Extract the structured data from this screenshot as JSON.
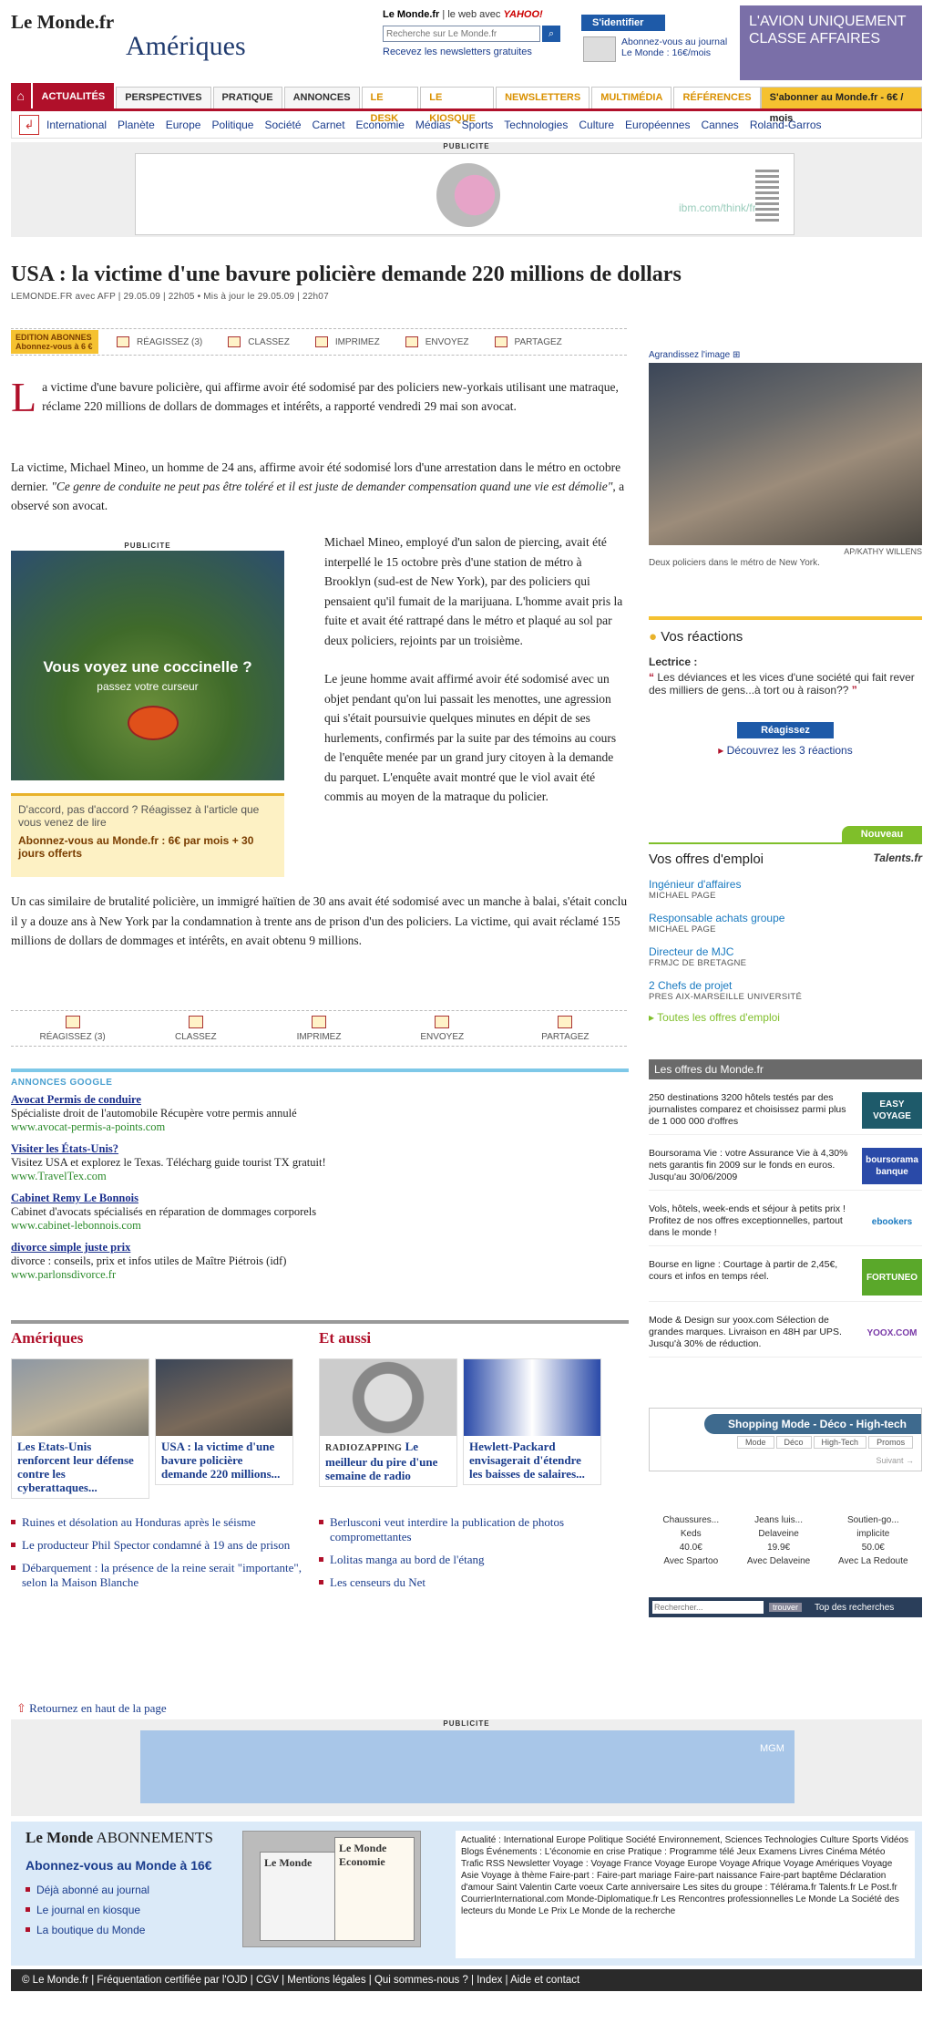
{
  "header": {
    "logo": "Le Monde.fr",
    "section": "Amériques",
    "search_brand": "Le Monde.fr",
    "search_sep": "le web avec",
    "yahoo": "YAHOO!",
    "search_placeholder": "Recherche sur Le Monde.fr",
    "newsletter": "Recevez les newsletters gratuites",
    "identify": "S'identifier",
    "subscribe_line1": "Abonnez-vous au journal",
    "subscribe_line2": "Le Monde : 16€/mois",
    "ad_top": "L'AVION UNIQUEMENT CLASSE AFFAIRES"
  },
  "nav": {
    "tabs": [
      "ACTUALITÉS",
      "PERSPECTIVES",
      "PRATIQUE",
      "ANNONCES",
      "LE DESK",
      "LE KIOSQUE",
      "NEWSLETTERS",
      "MULTIMÉDIA",
      "RÉFÉRENCES"
    ],
    "subscribe": "S'abonner au Monde.fr - 6€ / mois",
    "sub": [
      "International",
      "Planète",
      "Europe",
      "Politique",
      "Société",
      "Carnet",
      "Economie",
      "Médias",
      "Sports",
      "Technologies",
      "Culture",
      "Européennes",
      "Cannes",
      "Roland-Garros"
    ]
  },
  "ads": {
    "pub_label": "PUBLICITE",
    "ibm_url": "ibm.com/think/fr",
    "inline_title": "Vous voyez une coccinelle ?",
    "inline_sub": "passez votre curseur",
    "mgm": "MGM"
  },
  "article": {
    "headline": "USA : la victime d'une bavure policière demande 220 millions de dollars",
    "byline": "LEMONDE.FR avec AFP | 29.05.09 | 22h05 • Mis à jour le 29.05.09 | 22h07",
    "edition": "EDITION ABONNES Abonnez-vous à 6 €",
    "tools": [
      "RÉAGISSEZ (3)",
      "CLASSEZ",
      "IMPRIMEZ",
      "ENVOYEZ",
      "PARTAGEZ"
    ],
    "dropcap": "L",
    "lede": "a victime d'une bavure policière, qui affirme avoir été sodomisé par des policiers new-yorkais utilisant une matraque, réclame 220 millions de dollars de dommages et intérêts, a rapporté vendredi 29 mai son avocat.",
    "para2a": "La victime, Michael Mineo, un homme de 24 ans, affirme avoir été sodomisé lors d'une arrestation dans le métro en octobre dernier. ",
    "para2b": "\"Ce genre de conduite ne peut pas être toléré et il est juste de demander compensation quand une vie est démolie\"",
    "para2c": ", a observé son avocat.",
    "col1": "Michael Mineo, employé d'un salon de piercing, avait été interpellé le 15 octobre près d'une station de métro à Brooklyn (sud-est de New York), par des policiers qui pensaient qu'il fumait de la marijuana. L'homme avait pris la fuite et avait été rattrapé dans le métro et plaqué au sol par deux policiers, rejoints par un troisième.",
    "col2": "Le jeune homme avait affirmé avoir été sodomisé avec un objet pendant qu'on lui passait les menottes, une agression qui s'était poursuivie quelques minutes en dépit de ses hurlements, confirmés par la suite par des témoins au cours de l'enquête menée par un grand jury citoyen à la demande du parquet. L'enquête avait montré que le viol avait été commis au moyen de la matraque du policier.",
    "last": "Un cas similaire de brutalité policière, un immigré haïtien de 30 ans avait été sodomisé avec un manche à balai, s'était conclu il y a douze ans à New York par la condamnation à trente ans de prison d'un des policiers. La victime, qui avait réclamé 155 millions de dollars de dommages et intérêts, en avait obtenu 9 millions.",
    "react_box": "D'accord, pas d'accord ? Réagissez à l'article que vous venez de lire",
    "react_cta": "Abonnez-vous au Monde.fr : 6€ par mois + 30 jours offerts"
  },
  "google_ads": {
    "header": "ANNONCES GOOGLE",
    "items": [
      {
        "title": "Avocat Permis de conduire",
        "desc": "Spécialiste droit de l'automobile Récupère votre permis annulé",
        "url": "www.avocat-permis-a-points.com"
      },
      {
        "title": "Visiter les États-Unis?",
        "desc": "Visitez USA et explorez le Texas. Télécharg guide tourist TX gratuit!",
        "url": "www.TravelTex.com"
      },
      {
        "title": "Cabinet Remy Le Bonnois",
        "desc": "Cabinet d'avocats spécialisés en réparation de dommages corporels",
        "url": "www.cabinet-lebonnois.com"
      },
      {
        "title": "divorce simple juste prix",
        "desc": "divorce : conseils, prix et infos utiles de Maître Piétrois (idf)",
        "url": "www.parlonsdivorce.fr"
      }
    ]
  },
  "bottom": {
    "amer_title": "Amériques",
    "aussi_title": "Et aussi",
    "cards": [
      {
        "kicker": "",
        "title": "Les Etats-Unis renforcent leur défense contre les cyberattaques..."
      },
      {
        "kicker": "",
        "title": "USA : la victime d'une bavure policière demande 220 millions..."
      },
      {
        "kicker": "RADIOZAPPING",
        "title": "Le meilleur du pire d'une semaine de radio"
      },
      {
        "kicker": "",
        "title": "Hewlett-Packard envisagerait d'étendre les baisses de salaires..."
      }
    ],
    "amer_list": [
      "Ruines et désolation au Honduras après le séisme",
      "Le producteur Phil Spector condamné à 19 ans de prison",
      "Débarquement : la présence de la reine serait \"importante\", selon la Maison Blanche"
    ],
    "aussi_list": [
      "Berlusconi veut interdire la publication de photos compromettantes",
      "Lolitas manga au bord de l'étang",
      "Les censeurs du Net"
    ],
    "back_top": "Retournez en haut de la page"
  },
  "right": {
    "enlarge": "Agrandissez l'image",
    "credit": "AP/KATHY WILLENS",
    "caption": "Deux policiers dans le métro de New York.",
    "reactions_title": "Vos réactions",
    "lectrice": "Lectrice :",
    "quote": "Les déviances et les vices d'une société qui fait rever des milliers de gens...à tort ou à raison??",
    "react_btn": "Réagissez",
    "react_link": "Découvrez les 3 réactions",
    "jobs_new": "Nouveau",
    "jobs_title": "Vos offres d'emploi",
    "jobs_brand": "Talents.fr",
    "jobs": [
      {
        "title": "Ingénieur d'affaires",
        "company": "MICHAEL PAGE"
      },
      {
        "title": "Responsable achats groupe",
        "company": "MICHAEL PAGE"
      },
      {
        "title": "Directeur de MJC",
        "company": "FRMJC DE BRETAGNE"
      },
      {
        "title": "2 Chefs de projet",
        "company": "PRES AIX-MARSEILLE UNIVERSITÉ"
      }
    ],
    "jobs_all": "Toutes les offres d'emploi",
    "offres_title": "Les offres du Monde.fr",
    "offres": [
      {
        "text": "250 destinations 3200 hôtels testés par des journalistes comparez et choisissez parmi plus de 1 000 000 d'offres",
        "logo": "EASY VOYAGE",
        "color": "#1e5a6a"
      },
      {
        "text": "Boursorama Vie : votre Assurance Vie à 4,30% nets garantis fin 2009 sur le fonds en euros. Jusqu'au 30/06/2009",
        "logo": "boursorama banque",
        "color": "#2a4aa8"
      },
      {
        "text": "Vols, hôtels, week-ends et séjour à petits prix ! Profitez de nos offres exceptionnelles, partout dans le monde !",
        "logo": "ebookers",
        "color": "#1a7ac0"
      },
      {
        "text": "Bourse en ligne : Courtage à partir de 2,45€, cours et infos en temps réel.",
        "logo": "FORTUNEO",
        "color": "#5aa82a"
      },
      {
        "text": "Mode & Design sur yoox.com Sélection de grandes marques. Livraison en 48H par UPS. Jusqu'à 30% de réduction.",
        "logo": "YOOX.COM",
        "color": "#7a3aa8"
      }
    ],
    "shop_title": "Shopping Mode - Déco - High-tech",
    "shop_tabs": [
      "Mode",
      "Déco",
      "High-Tech",
      "Promos"
    ],
    "shop_next": "Suivant",
    "shop_items": [
      {
        "name": "Chaussures...",
        "brand": "Keds",
        "price": "40.0€",
        "shop": "Avec Spartoo"
      },
      {
        "name": "Jeans luis...",
        "brand": "Delaveine",
        "price": "19.9€",
        "shop": "Avec Delaveine"
      },
      {
        "name": "Soutien-go...",
        "brand": "implicite",
        "price": "50.0€",
        "shop": "Avec La Redoute"
      }
    ],
    "shop_search": "Rechercher...",
    "shop_trouver": "trouver",
    "shop_top": "Top des recherches"
  },
  "footer": {
    "ab_brand": "Le Monde",
    "ab_label": "ABONNEMENTS",
    "ab_offer": "Abonnez-vous au Monde à 16€",
    "ab_links": [
      "Déjà abonné au journal",
      "Le journal en kiosque",
      "La boutique du Monde"
    ],
    "paper1": "Le Monde",
    "paper2": "Le Monde Economie",
    "sites": "Actualité : International Europe Politique Société Environnement, Sciences Technologies Culture Sports Vidéos Blogs Événements : L'économie en crise Pratique : Programme télé Jeux Examens Livres Cinéma Météo Trafic RSS Newsletter Voyage : Voyage France Voyage Europe Voyage Afrique Voyage Amériques Voyage Asie Voyage à thème Faire-part : Faire-part mariage Faire-part naissance Faire-part baptême Déclaration d'amour Saint Valentin Carte voeux Carte anniversaire Les sites du groupe : Télérama.fr Talents.fr Le Post.fr CourrierInternational.com Monde-Diplomatique.fr Les Rencontres professionnelles Le Monde La Société des lecteurs du Monde Le Prix Le Monde de la recherche",
    "bar": "© Le Monde.fr | Fréquentation certifiée par l'OJD | CGV | Mentions légales | Qui sommes-nous ? | Index | Aide et contact"
  }
}
